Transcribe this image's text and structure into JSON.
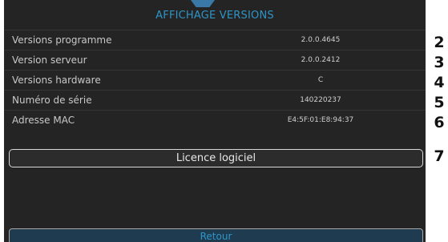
{
  "screen": {
    "title": "AFFICHAGE VERSIONS",
    "rows": [
      {
        "label": "Versions programme",
        "value": "2.0.0.4645",
        "callout": "2"
      },
      {
        "label": "Version serveur",
        "value": "2.0.0.2412",
        "callout": "3"
      },
      {
        "label": "Versions hardware",
        "value": "C",
        "callout": "4"
      },
      {
        "label": "Numéro de série",
        "value": "140220237",
        "callout": "5"
      },
      {
        "label": "Adresse MAC",
        "value": "E4:5F:01:E8:94:37",
        "callout": "6"
      }
    ],
    "licence_button": {
      "label": "Licence logiciel",
      "callout": "7"
    },
    "back_button": {
      "label": "Retour"
    }
  },
  "colors": {
    "accent": "#2f95c7",
    "background": "#242424",
    "text": "#c8c8c8"
  }
}
